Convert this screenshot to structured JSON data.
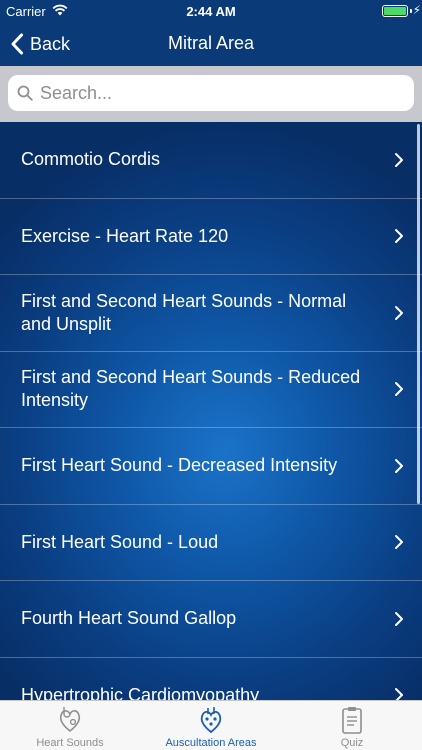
{
  "status": {
    "carrier": "Carrier",
    "time": "2:44 AM",
    "battery_level": 1.0
  },
  "nav": {
    "back_label": "Back",
    "title": "Mitral Area"
  },
  "search": {
    "placeholder": "Search...",
    "value": ""
  },
  "list": {
    "items": [
      {
        "label": "Commotio Cordis"
      },
      {
        "label": "Exercise - Heart Rate 120"
      },
      {
        "label": "First and Second Heart Sounds - Normal and Unsplit"
      },
      {
        "label": "First and Second Heart Sounds - Reduced Intensity"
      },
      {
        "label": "First Heart Sound - Decreased Intensity"
      },
      {
        "label": "First Heart Sound - Loud"
      },
      {
        "label": "Fourth Heart Sound Gallop"
      },
      {
        "label": "Hypertrophic Cardiomyopathy"
      }
    ]
  },
  "tabs": [
    {
      "label": "Heart Sounds",
      "icon": "heart-stethoscope-icon",
      "active": false
    },
    {
      "label": "Auscultation Areas",
      "icon": "heart-areas-icon",
      "active": true
    },
    {
      "label": "Quiz",
      "icon": "clipboard-icon",
      "active": false
    }
  ],
  "colors": {
    "bar": "#0a3b78",
    "accent": "#1a5fb4",
    "battery": "#4cd964",
    "tab_inactive": "#8e8e93"
  }
}
